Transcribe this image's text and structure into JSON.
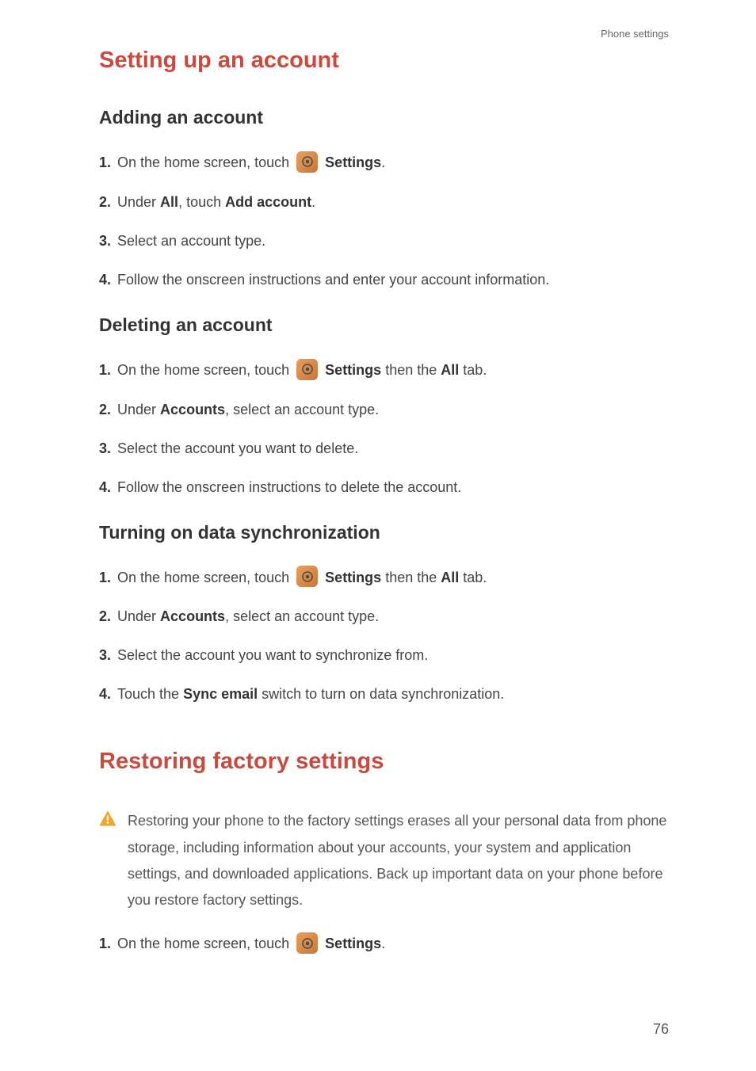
{
  "header": {
    "breadcrumb": "Phone settings"
  },
  "section1": {
    "title": "Setting up an account",
    "sub1": {
      "title": "Adding an account",
      "steps": [
        {
          "num": "1.",
          "pre": "On the home screen, touch ",
          "bold1": "Settings",
          "post": "."
        },
        {
          "num": "2.",
          "pre": "Under ",
          "bold1": "All",
          "mid": ", touch ",
          "bold2": "Add account",
          "post": "."
        },
        {
          "num": "3.",
          "text": "Select an account type."
        },
        {
          "num": "4.",
          "text": "Follow the onscreen instructions and enter your account information."
        }
      ]
    },
    "sub2": {
      "title": "Deleting an account",
      "steps": [
        {
          "num": "1.",
          "pre": "On the home screen, touch ",
          "bold1": "Settings",
          "mid": " then the ",
          "bold2": "All",
          "post": " tab."
        },
        {
          "num": "2.",
          "pre": "Under ",
          "bold1": "Accounts",
          "post": ", select an account type."
        },
        {
          "num": "3.",
          "text": "Select the account you want to delete."
        },
        {
          "num": "4.",
          "text": "Follow the onscreen instructions to delete the account."
        }
      ]
    },
    "sub3": {
      "title": "Turning on data synchronization",
      "steps": [
        {
          "num": "1.",
          "pre": "On the home screen, touch ",
          "bold1": "Settings",
          "mid": " then the ",
          "bold2": "All",
          "post": " tab."
        },
        {
          "num": "2.",
          "pre": "Under ",
          "bold1": "Accounts",
          "post": ", select an account type."
        },
        {
          "num": "3.",
          "text": "Select the account you want to synchronize from."
        },
        {
          "num": "4.",
          "pre": "Touch the ",
          "bold1": "Sync email",
          "post": " switch to turn on data synchronization."
        }
      ]
    }
  },
  "section2": {
    "title": "Restoring factory settings",
    "warning": "Restoring your phone to the factory settings erases all your personal data from phone storage, including information about your accounts, your system and application settings, and downloaded applications. Back up important data on your phone before you restore factory settings.",
    "steps": [
      {
        "num": "1.",
        "pre": "On the home screen, touch ",
        "bold1": "Settings",
        "post": "."
      }
    ]
  },
  "pageNumber": "76"
}
